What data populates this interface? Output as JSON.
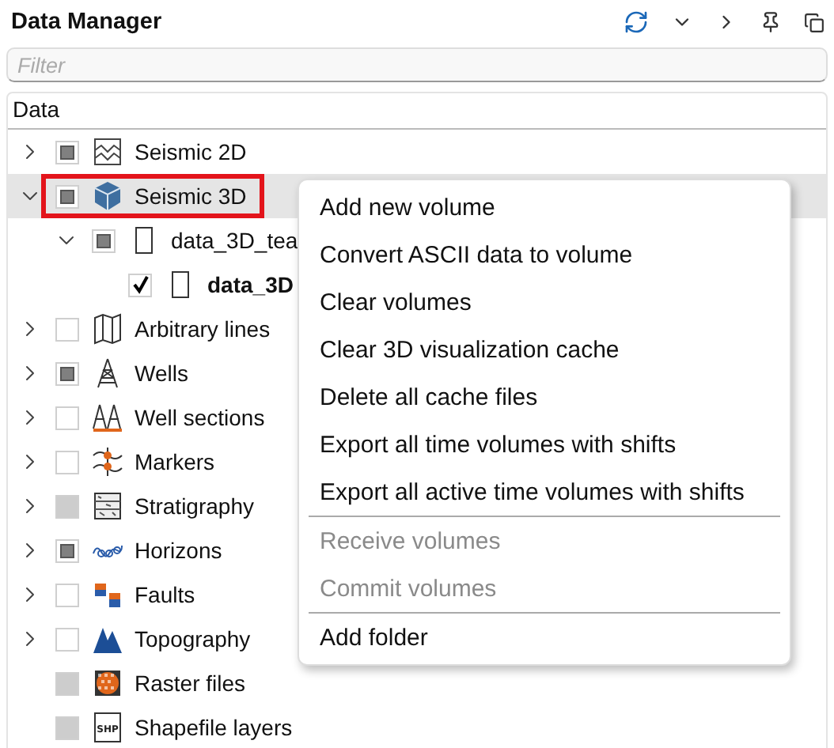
{
  "panel": {
    "title": "Data Manager"
  },
  "filter": {
    "placeholder": "Filter"
  },
  "tree": {
    "header": "Data",
    "items": [
      {
        "label": "Seismic 2D",
        "kind": "seismic2d",
        "checked": false,
        "partial": true,
        "disabled": false,
        "expanded": false,
        "highlighted": false,
        "bold": false
      },
      {
        "label": "Seismic 3D",
        "kind": "cube",
        "checked": false,
        "partial": true,
        "disabled": false,
        "expanded": true,
        "highlighted": true,
        "bold": false,
        "children": [
          {
            "label": "data_3D_tea",
            "kind": "file",
            "checked": false,
            "partial": true,
            "disabled": false,
            "expanded": true,
            "highlighted": false,
            "bold": false,
            "children": [
              {
                "label": "data_3D",
                "kind": "file",
                "checked": true,
                "partial": false,
                "disabled": false,
                "highlighted": false,
                "bold": true
              }
            ]
          }
        ]
      },
      {
        "label": "Arbitrary lines",
        "kind": "map",
        "checked": false,
        "partial": false,
        "disabled": false,
        "expanded": false,
        "highlighted": false,
        "bold": false
      },
      {
        "label": "Wells",
        "kind": "well",
        "checked": false,
        "partial": true,
        "disabled": false,
        "expanded": false,
        "highlighted": false,
        "bold": false
      },
      {
        "label": "Well sections",
        "kind": "wells",
        "checked": false,
        "partial": false,
        "disabled": false,
        "expanded": false,
        "highlighted": false,
        "bold": false
      },
      {
        "label": "Markers",
        "kind": "markers",
        "checked": false,
        "partial": false,
        "disabled": false,
        "expanded": false,
        "highlighted": false,
        "bold": false
      },
      {
        "label": "Stratigraphy",
        "kind": "strat",
        "checked": false,
        "partial": false,
        "disabled": true,
        "expanded": false,
        "highlighted": false,
        "bold": false
      },
      {
        "label": "Horizons",
        "kind": "horizons",
        "checked": false,
        "partial": true,
        "disabled": false,
        "expanded": false,
        "highlighted": false,
        "bold": false
      },
      {
        "label": "Faults",
        "kind": "faults",
        "checked": false,
        "partial": false,
        "disabled": false,
        "expanded": false,
        "highlighted": false,
        "bold": false
      },
      {
        "label": "Topography",
        "kind": "topo",
        "checked": false,
        "partial": false,
        "disabled": false,
        "expanded": false,
        "highlighted": false,
        "bold": false
      },
      {
        "label": "Raster files",
        "kind": "raster",
        "checked": false,
        "partial": false,
        "disabled": true,
        "highlighted": false,
        "bold": false
      },
      {
        "label": "Shapefile layers",
        "kind": "shp",
        "iconText": "SHP",
        "checked": false,
        "partial": false,
        "disabled": true,
        "highlighted": false,
        "bold": false
      }
    ]
  },
  "context_menu": {
    "items": [
      {
        "kind": "item",
        "label": "Add new volume",
        "disabled": false
      },
      {
        "kind": "item",
        "label": "Convert ASCII data to volume",
        "disabled": false
      },
      {
        "kind": "item",
        "label": "Clear volumes",
        "disabled": false
      },
      {
        "kind": "item",
        "label": "Clear 3D visualization cache",
        "disabled": false
      },
      {
        "kind": "item",
        "label": "Delete all cache files",
        "disabled": false
      },
      {
        "kind": "item",
        "label": "Export all time volumes with shifts",
        "disabled": false
      },
      {
        "kind": "item",
        "label": "Export all active time volumes with shifts",
        "disabled": false
      },
      {
        "kind": "separator"
      },
      {
        "kind": "item",
        "label": "Receive volumes",
        "disabled": true
      },
      {
        "kind": "item",
        "label": "Commit volumes",
        "disabled": true
      },
      {
        "kind": "separator"
      },
      {
        "kind": "item",
        "label": "Add folder",
        "disabled": false
      }
    ]
  }
}
